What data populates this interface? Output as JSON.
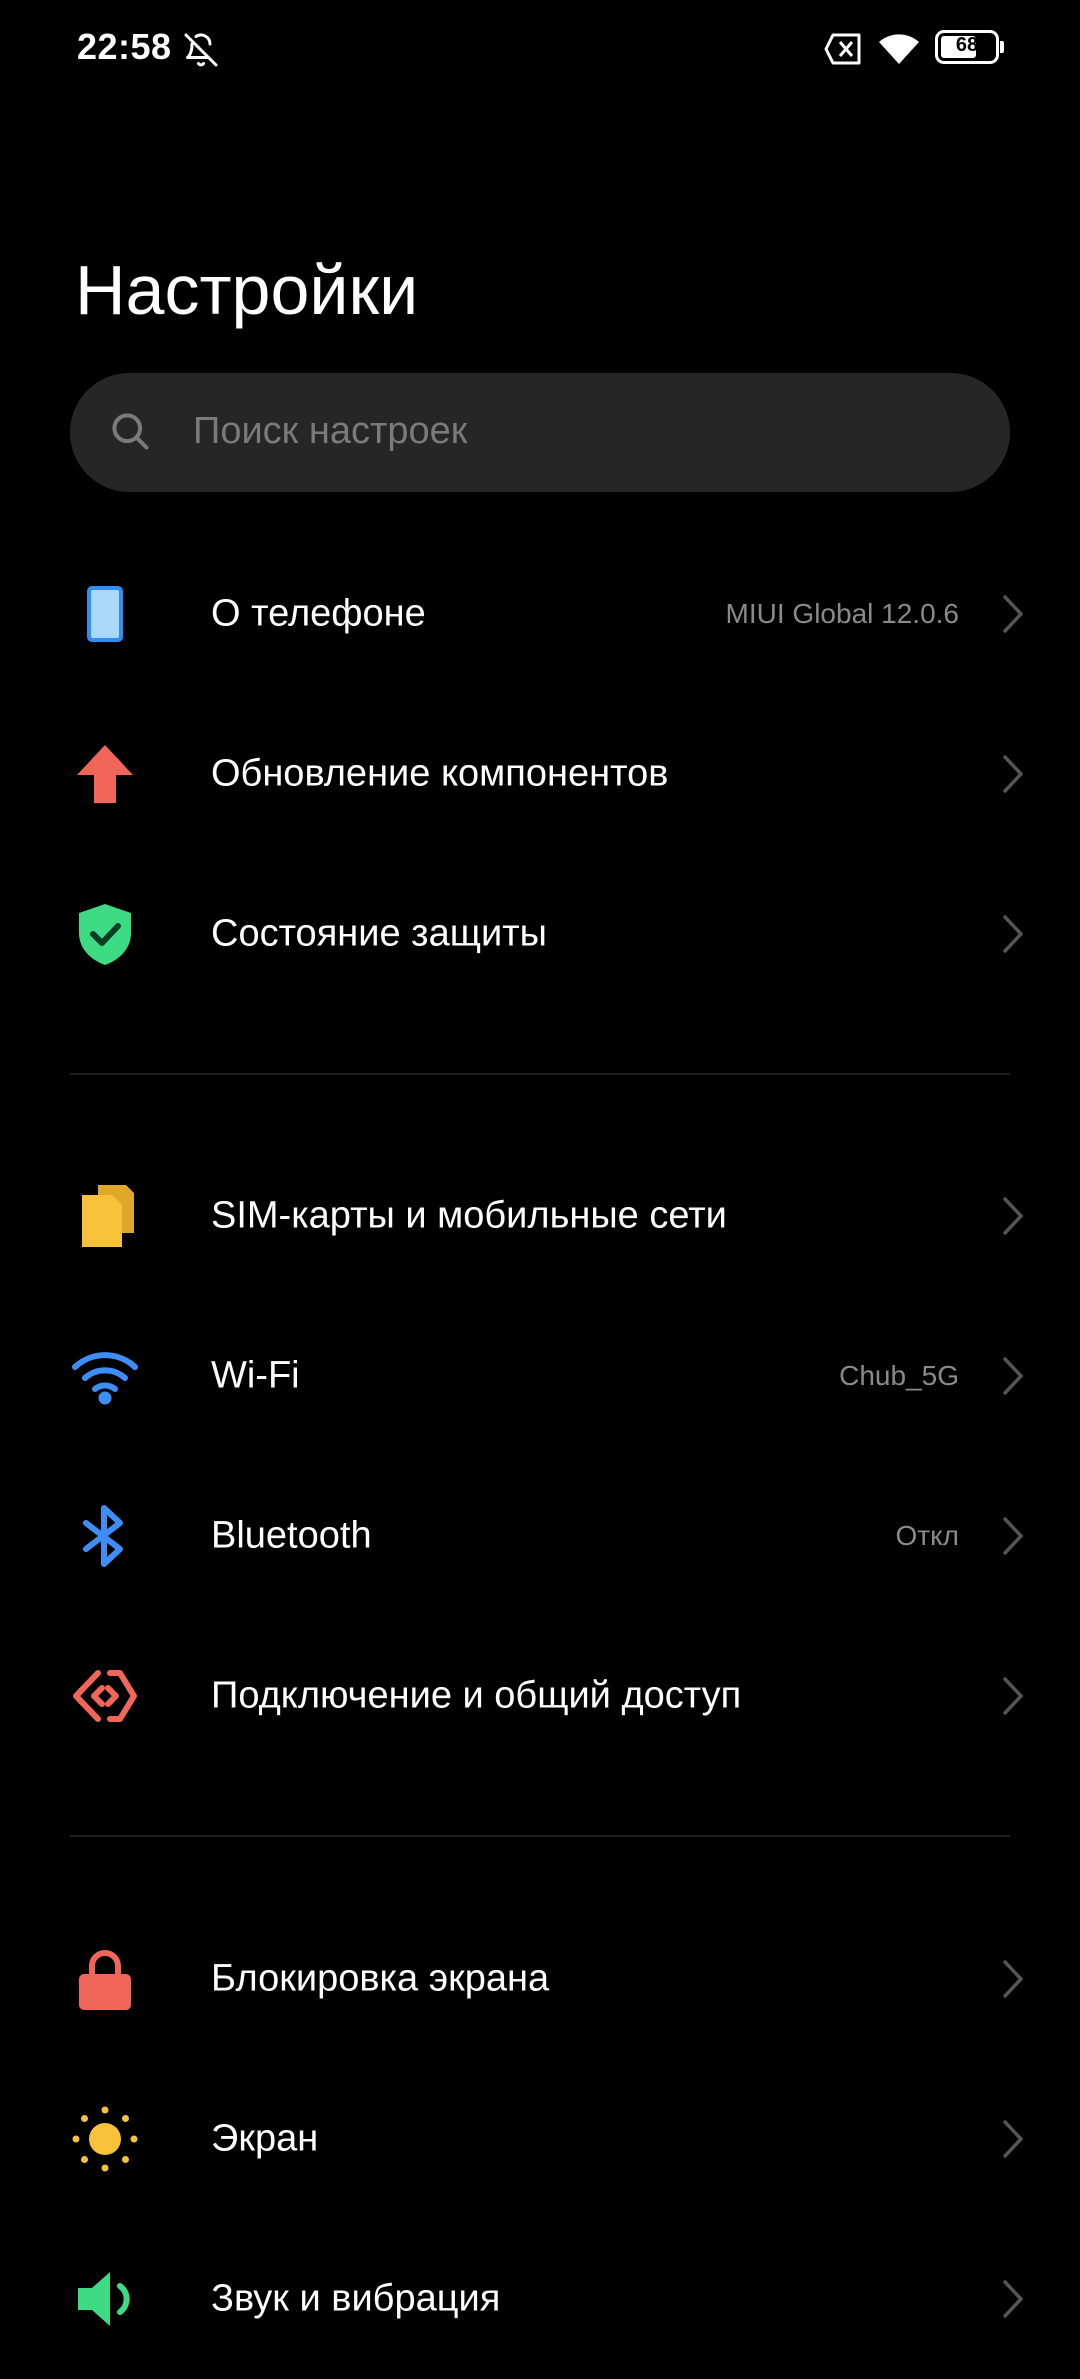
{
  "status_bar": {
    "time": "22:58",
    "battery_level": "68",
    "icons": [
      "bell-off-icon",
      "sim-x-icon",
      "wifi-icon",
      "battery-icon"
    ]
  },
  "header": {
    "title": "Настройки"
  },
  "search": {
    "placeholder": "Поиск настроек"
  },
  "sections": [
    {
      "items": [
        {
          "label": "О телефоне",
          "value": "MIUI Global 12.0.6",
          "icon": "phone-icon",
          "color": "#5aa9f5"
        },
        {
          "label": "Обновление компонентов",
          "value": "",
          "icon": "arrow-up-icon",
          "color": "#f2665a"
        },
        {
          "label": "Состояние защиты",
          "value": "",
          "icon": "shield-check-icon",
          "color": "#3ddc84"
        }
      ]
    },
    {
      "items": [
        {
          "label": "SIM-карты и мобильные сети",
          "value": "",
          "icon": "sim-card-icon",
          "color": "#f7c23a"
        },
        {
          "label": "Wi-Fi",
          "value": "Chub_5G",
          "icon": "wifi-icon",
          "color": "#3d8ff5"
        },
        {
          "label": "Bluetooth",
          "value": "Откл",
          "icon": "bluetooth-icon",
          "color": "#3d8ff5"
        },
        {
          "label": "Подключение и общий доступ",
          "value": "",
          "icon": "connection-icon",
          "color": "#f2665a"
        }
      ]
    },
    {
      "items": [
        {
          "label": "Блокировка экрана",
          "value": "",
          "icon": "lock-icon",
          "color": "#f2665a"
        },
        {
          "label": "Экран",
          "value": "",
          "icon": "sun-icon",
          "color": "#f7c23a"
        },
        {
          "label": "Звук и вибрация",
          "value": "",
          "icon": "speaker-icon",
          "color": "#3ddc84"
        }
      ]
    }
  ]
}
